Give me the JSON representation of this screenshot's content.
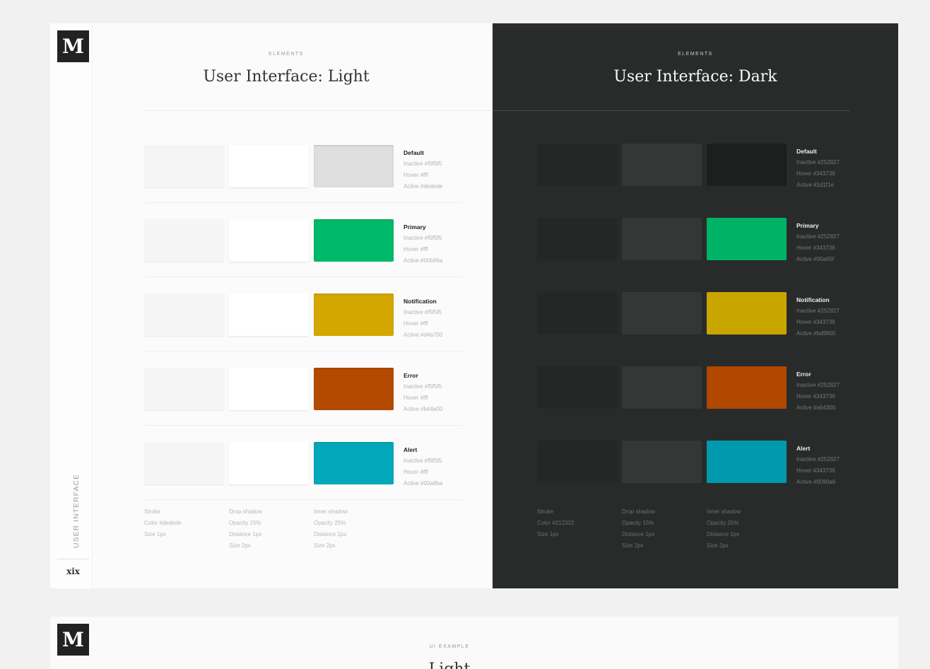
{
  "logo": "M",
  "sidebar": {
    "label": "USER INTERFACE",
    "page": "xix"
  },
  "light": {
    "eyebrow": "ELEMENTS",
    "title": "User Interface: Light",
    "rows": [
      {
        "name": "Default",
        "inactive": "Inactive #f5f5f5",
        "hover": "Hover #fff",
        "active": "Active #dedede",
        "active_color": "#dedede"
      },
      {
        "name": "Primary",
        "inactive": "Inactive #f5f5f5",
        "hover": "Hover #fff",
        "active": "Active #00b96a",
        "active_color": "#00b96a"
      },
      {
        "name": "Notification",
        "inactive": "Inactive #f5f5f5",
        "hover": "Hover #fff",
        "active": "Active #d4a700",
        "active_color": "#d4a700"
      },
      {
        "name": "Error",
        "inactive": "Inactive #f5f5f5",
        "hover": "Hover #fff",
        "active": "Active #b44a00",
        "active_color": "#b44a00"
      },
      {
        "name": "Alert",
        "inactive": "Inactive #f5f5f5",
        "hover": "Hover #fff",
        "active": "Active #00a8ba",
        "active_color": "#00a8ba"
      }
    ],
    "legend": {
      "stroke": [
        "Stroke",
        "Color #dedede",
        "Size 1px"
      ],
      "drop_shadow": [
        "Drop shadow",
        "Opacity 15%",
        "Distance 1px",
        "Size 2px"
      ],
      "inner_shadow": [
        "Inner shadow",
        "Opacity 25%",
        "Distance 1px",
        "Size 2px"
      ]
    }
  },
  "dark": {
    "eyebrow": "ELEMENTS",
    "title": "User Interface: Dark",
    "rows": [
      {
        "name": "Default",
        "inactive": "Inactive #252827",
        "hover": "Hover #343736",
        "active": "Active #1d1f1e",
        "active_color": "#1d1f1e"
      },
      {
        "name": "Primary",
        "inactive": "Inactive #252827",
        "hover": "Hover #343736",
        "active": "Active #00a65f",
        "active_color": "#00b265"
      },
      {
        "name": "Notification",
        "inactive": "Inactive #252827",
        "hover": "Hover #343736",
        "active": "Active #bd9900",
        "active_color": "#c9a500"
      },
      {
        "name": "Error",
        "inactive": "Inactive #252827",
        "hover": "Hover #343736",
        "active": "Active #a64300",
        "active_color": "#b04800"
      },
      {
        "name": "Alert",
        "inactive": "Inactive #252827",
        "hover": "Hover #343736",
        "active": "Active #0090a6",
        "active_color": "#0099ad"
      }
    ],
    "legend": {
      "stroke": [
        "Stroke",
        "Color #212322",
        "Size 1px"
      ],
      "drop_shadow": [
        "Drop shadow",
        "Opacity 15%",
        "Distance 1px",
        "Size 2px"
      ],
      "inner_shadow": [
        "Inner shadow",
        "Opacity 25%",
        "Distance 1px",
        "Size 2px"
      ]
    }
  },
  "bottom": {
    "eyebrow": "UI EXAMPLE",
    "title": "Light"
  }
}
